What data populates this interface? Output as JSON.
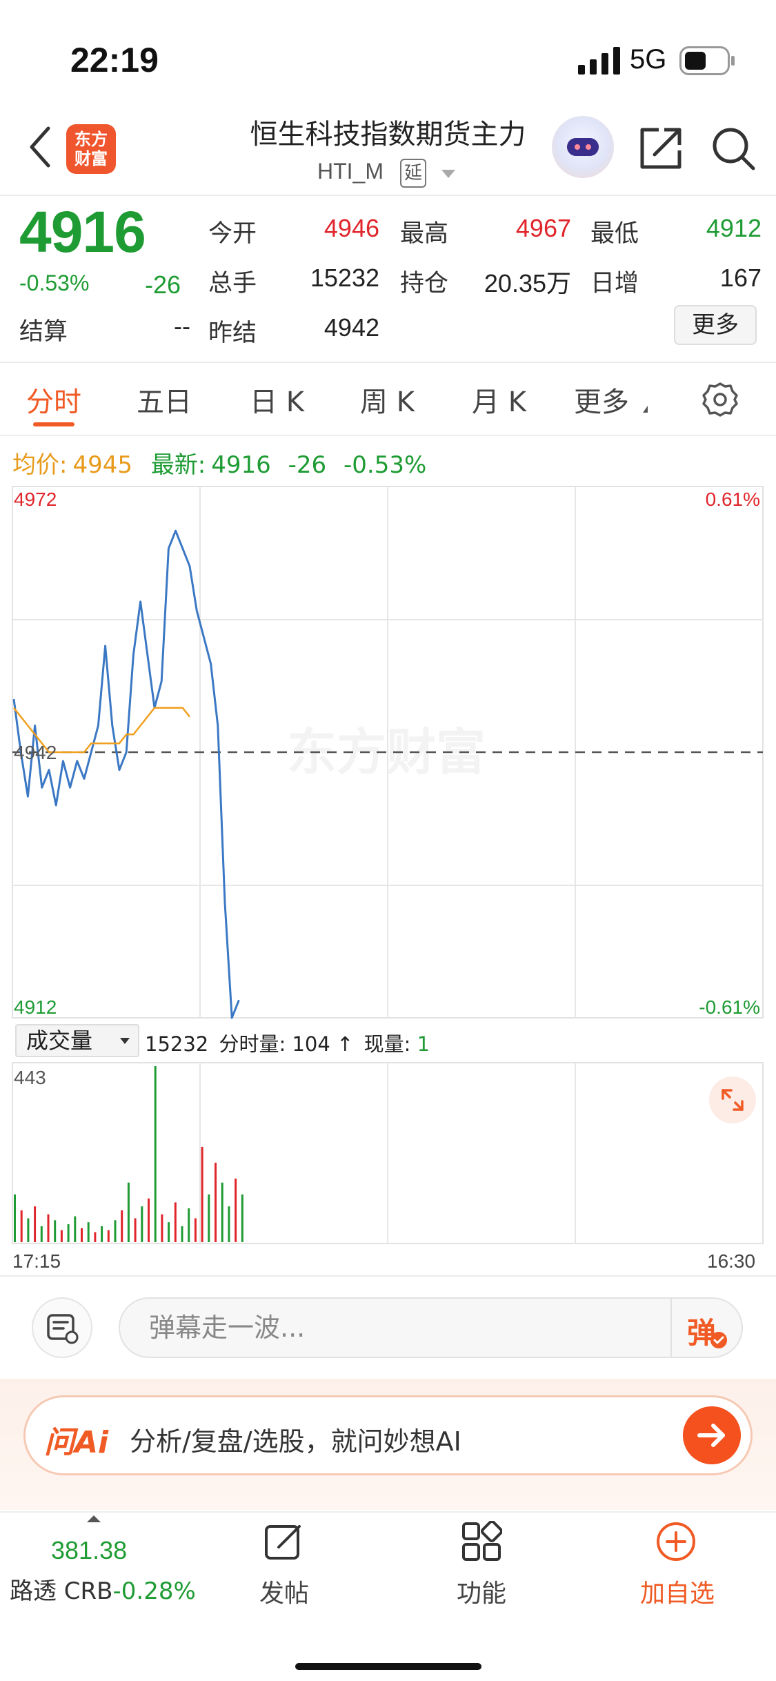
{
  "status_bar": {
    "time": "22:19",
    "network": "5G"
  },
  "header": {
    "logo_line1": "东方",
    "logo_line2": "财富",
    "title": "恒生科技指数期货主力",
    "subtitle": "HTI_M",
    "delay_tag": "延"
  },
  "quote": {
    "price": "4916",
    "change_pct": "-0.53%",
    "change": "-26",
    "settlement_label": "结算",
    "settlement_value": "--",
    "fields": [
      {
        "label": "今开",
        "value": "4946",
        "color": "#e0252b"
      },
      {
        "label": "最高",
        "value": "4967",
        "color": "#e0252b"
      },
      {
        "label": "最低",
        "value": "4912",
        "color": "#1e9b33"
      },
      {
        "label": "总手",
        "value": "15232",
        "color": "#222222"
      },
      {
        "label": "持仓",
        "value": "20.35万",
        "color": "#222222"
      },
      {
        "label": "日增",
        "value": "167",
        "color": "#222222"
      },
      {
        "label": "昨结",
        "value": "4942",
        "color": "#222222"
      }
    ],
    "more_button": "更多"
  },
  "tabs": [
    {
      "label": "分时",
      "active": true
    },
    {
      "label": "五日",
      "active": false
    },
    {
      "label": "日 K",
      "active": false
    },
    {
      "label": "周 K",
      "active": false
    },
    {
      "label": "月 K",
      "active": false
    },
    {
      "label": "更多",
      "active": false
    }
  ],
  "info_line": {
    "avg_label": "均价:",
    "avg_value": "4945",
    "latest_label": "最新:",
    "latest_value": "4916",
    "latest_change": "-26",
    "latest_pct": "-0.53%"
  },
  "chart_data": {
    "type": "line",
    "title": "",
    "y_top": "4972",
    "y_mid": "4942",
    "y_bottom": "4912",
    "pct_top": "0.61%",
    "pct_bottom": "-0.61%",
    "watermark": "东方财富",
    "ylim": [
      4912,
      4972
    ],
    "prev_settle": 4942,
    "grid": true,
    "series": [
      {
        "name": "price",
        "color": "#3b78c4",
        "values": [
          4948,
          4942,
          4937,
          4945,
          4938,
          4940,
          4936,
          4941,
          4938,
          4941,
          4939,
          4942,
          4945,
          4954,
          4945,
          4940,
          4942,
          4953,
          4959,
          4953,
          4947,
          4950,
          4965,
          4967,
          4965,
          4963,
          4958,
          4955,
          4952,
          4945,
          4925,
          4912,
          4914
        ]
      },
      {
        "name": "avg",
        "color": "#f0a020",
        "values": [
          4947,
          4946,
          4945,
          4944,
          4943,
          4942,
          4942,
          4942,
          4942,
          4942,
          4942,
          4943,
          4943,
          4943,
          4943,
          4943,
          4944,
          4944,
          4945,
          4946,
          4947,
          4947,
          4947,
          4947,
          4947,
          4946
        ]
      }
    ],
    "volume": {
      "max_label": "443",
      "max": 443,
      "bars": [
        {
          "v": 120,
          "c": "g"
        },
        {
          "v": 80,
          "c": "r"
        },
        {
          "v": 60,
          "c": "g"
        },
        {
          "v": 90,
          "c": "r"
        },
        {
          "v": 40,
          "c": "g"
        },
        {
          "v": 70,
          "c": "r"
        },
        {
          "v": 55,
          "c": "g"
        },
        {
          "v": 30,
          "c": "r"
        },
        {
          "v": 45,
          "c": "g"
        },
        {
          "v": 65,
          "c": "g"
        },
        {
          "v": 35,
          "c": "r"
        },
        {
          "v": 50,
          "c": "g"
        },
        {
          "v": 25,
          "c": "r"
        },
        {
          "v": 40,
          "c": "g"
        },
        {
          "v": 30,
          "c": "r"
        },
        {
          "v": 55,
          "c": "g"
        },
        {
          "v": 80,
          "c": "r"
        },
        {
          "v": 150,
          "c": "g"
        },
        {
          "v": 60,
          "c": "r"
        },
        {
          "v": 90,
          "c": "g"
        },
        {
          "v": 110,
          "c": "r"
        },
        {
          "v": 443,
          "c": "g"
        },
        {
          "v": 70,
          "c": "r"
        },
        {
          "v": 50,
          "c": "g"
        },
        {
          "v": 100,
          "c": "r"
        },
        {
          "v": 40,
          "c": "g"
        },
        {
          "v": 85,
          "c": "g"
        },
        {
          "v": 60,
          "c": "r"
        },
        {
          "v": 240,
          "c": "r"
        },
        {
          "v": 120,
          "c": "g"
        },
        {
          "v": 200,
          "c": "r"
        },
        {
          "v": 150,
          "c": "g"
        },
        {
          "v": 90,
          "c": "g"
        },
        {
          "v": 160,
          "c": "r"
        },
        {
          "v": 120,
          "c": "g"
        }
      ]
    },
    "time_start": "17:15",
    "time_end": "16:30"
  },
  "volume_bar": {
    "selector": "成交量",
    "total": "15232",
    "period_label": "分时量:",
    "period_value": "104",
    "arrow": "↑",
    "now_label": "现量:",
    "now_value": "1"
  },
  "comment": {
    "placeholder": "弹幕走一波...",
    "toggle": "弹"
  },
  "ai": {
    "logo": "问Ai",
    "text": "分析/复盘/选股，就问妙想AI"
  },
  "bottom_nav": {
    "index_value": "381.38",
    "index_name": "路透 CRB",
    "index_pct": "-0.28%",
    "post": "发帖",
    "function": "功能",
    "add": "加自选"
  },
  "colors": {
    "up": "#e0252b",
    "down": "#1e9b33",
    "accent": "#f05a24",
    "avg": "#f0a020",
    "price_line": "#3b78c4"
  }
}
